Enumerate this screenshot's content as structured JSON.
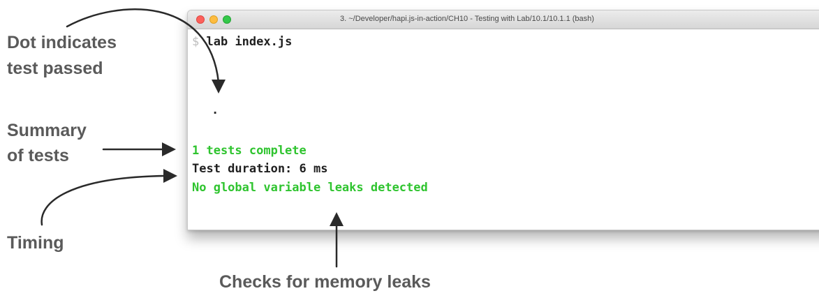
{
  "window": {
    "title": "3. ~/Developer/hapi.js-in-action/CH10 - Testing with Lab/10.1/10.1.1 (bash)",
    "traffic_lights": [
      "close",
      "minimize",
      "zoom"
    ]
  },
  "terminal": {
    "prompt": "$",
    "command": "lab index.js",
    "dot": ".",
    "tests_complete": "1 tests complete",
    "duration": "Test duration: 6 ms",
    "leaks": "No global variable leaks detected"
  },
  "annotations": {
    "dot_line1": "Dot indicates",
    "dot_line2": "test passed",
    "summary_line1": "Summary",
    "summary_line2": "of tests",
    "timing": "Timing",
    "memory": "Checks for memory leaks"
  },
  "colors": {
    "success_green": "#2fc42f",
    "annotation_gray": "#5a5a5a",
    "arrow": "#2a2a2a"
  }
}
